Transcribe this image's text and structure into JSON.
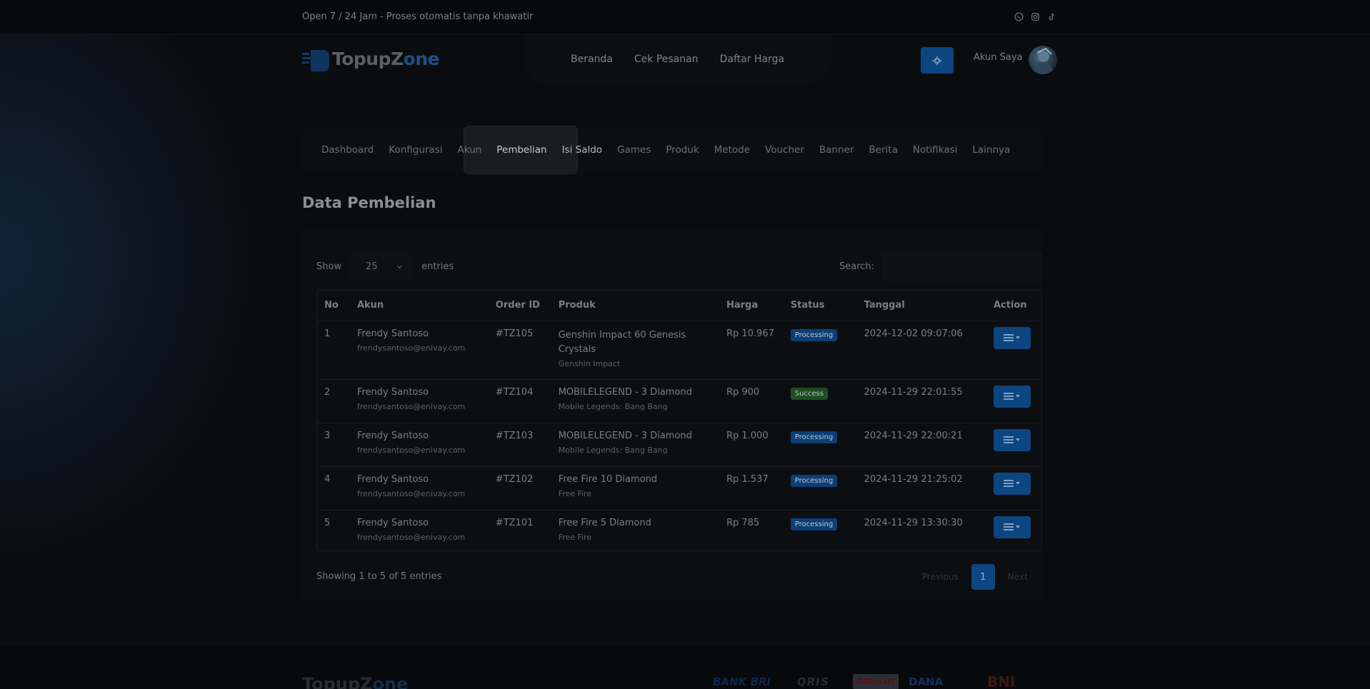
{
  "topbar": {
    "tagline": "Open 7 / 24 Jam - Proses otomatis tanpa khawatir",
    "social_icons": [
      "whatsapp-icon",
      "instagram-icon",
      "tiktok-icon"
    ]
  },
  "header": {
    "logo_part1": "TopupZ",
    "logo_o": "o",
    "logo_part2": "ne",
    "nav": [
      "Beranda",
      "Cek Pesanan",
      "Daftar Harga"
    ],
    "account_label": "Akun Saya"
  },
  "admin_tabs": {
    "items": [
      "Dashboard",
      "Konfigurasi",
      "Akun",
      "Pembelian",
      "Isi Saldo",
      "Games",
      "Produk",
      "Metode",
      "Voucher",
      "Banner",
      "Berita",
      "Notifikasi",
      "Lainnya"
    ],
    "active": "Pembelian"
  },
  "page": {
    "title": "Data Pembelian"
  },
  "table_controls": {
    "show_label": "Show",
    "entries_value": "25",
    "entries_label": "entries",
    "search_label": "Search:"
  },
  "table": {
    "columns": [
      "No",
      "Akun",
      "Order ID",
      "Produk",
      "Harga",
      "Status",
      "Tanggal",
      "Action"
    ],
    "rows": [
      {
        "no": "1",
        "name": "Frendy Santoso",
        "email": "frendysantoso@enivay.com",
        "order_id": "#TZ105",
        "product": "Genshin Impact 60 Genesis Crystals",
        "game": "Genshin Impact",
        "price": "Rp 10.967",
        "status": "Processing",
        "date": "2024-12-02 09:07:06"
      },
      {
        "no": "2",
        "name": "Frendy Santoso",
        "email": "frendysantoso@enivay.com",
        "order_id": "#TZ104",
        "product": "MOBILELEGEND - 3 Diamond",
        "game": "Mobile Legends: Bang Bang",
        "price": "Rp 900",
        "status": "Success",
        "date": "2024-11-29 22:01:55"
      },
      {
        "no": "3",
        "name": "Frendy Santoso",
        "email": "frendysantoso@enivay.com",
        "order_id": "#TZ103",
        "product": "MOBILELEGEND - 3 Diamond",
        "game": "Mobile Legends: Bang Bang",
        "price": "Rp 1.000",
        "status": "Processing",
        "date": "2024-11-29 22:00:21"
      },
      {
        "no": "4",
        "name": "Frendy Santoso",
        "email": "frendysantoso@enivay.com",
        "order_id": "#TZ102",
        "product": "Free Fire 10 Diamond",
        "game": "Free Fire",
        "price": "Rp 1.537",
        "status": "Processing",
        "date": "2024-11-29 21:25:02"
      },
      {
        "no": "5",
        "name": "Frendy Santoso",
        "email": "frendysantoso@enivay.com",
        "order_id": "#TZ101",
        "product": "Free Fire 5 Diamond",
        "game": "Free Fire",
        "price": "Rp 785",
        "status": "Processing",
        "date": "2024-11-29 13:30:30"
      }
    ]
  },
  "pagination": {
    "info": "Showing 1 to 5 of 5 entries",
    "previous": "Previous",
    "current": "1",
    "next": "Next"
  },
  "footer": {
    "logo_part1": "TopupZ",
    "logo_o": "o",
    "logo_part2": "ne",
    "payments": [
      "BANK BRI",
      "QRIS",
      "Alfamart",
      "DANA",
      "BNI"
    ]
  },
  "colors": {
    "accent": "#0c4680",
    "processing": "#0c3f75",
    "success": "#1e4d26",
    "background": "#0b0c10"
  }
}
